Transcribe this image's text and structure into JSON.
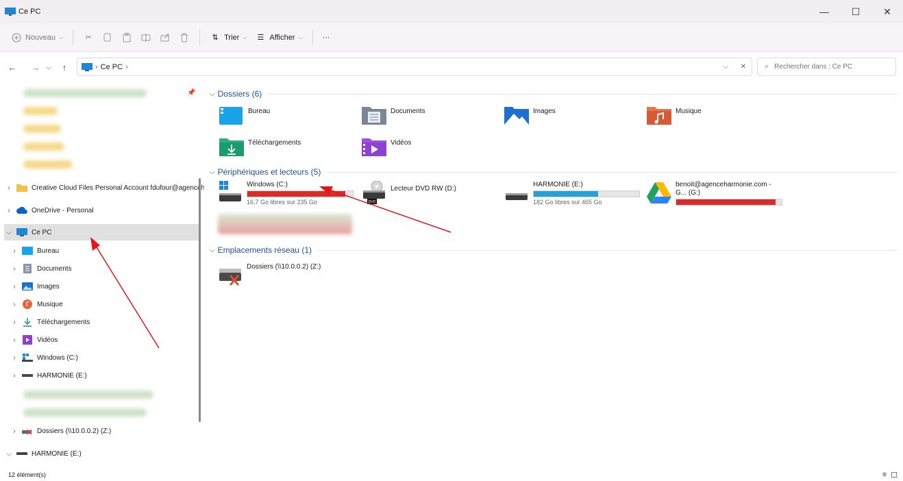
{
  "window": {
    "title": "Ce PC",
    "minimize": "—",
    "maximize": "☐",
    "close": "✕"
  },
  "toolbar": {
    "new_label": "Nouveau",
    "sort_label": "Trier",
    "view_label": "Afficher",
    "more_label": "···"
  },
  "address": {
    "crumb": "Ce PC",
    "search_placeholder": "Rechercher dans : Ce PC"
  },
  "nav": {
    "creative_cloud": "Creative Cloud Files Personal Account fdufour@agenceh",
    "onedrive": "OneDrive - Personal",
    "ce_pc": "Ce PC",
    "children": [
      "Bureau",
      "Documents",
      "Images",
      "Musique",
      "Téléchargements",
      "Vidéos",
      "Windows (C:)",
      "HARMONIE (E:)"
    ],
    "network": "Dossiers (\\\\10.0.0.2) (Z:)",
    "harmonie_root": "HARMONIE (E:)"
  },
  "groups": {
    "folders_header": "Dossiers (6)",
    "devices_header": "Périphériques et lecteurs (5)",
    "network_header": "Emplacements réseau (1)"
  },
  "folders": [
    "Bureau",
    "Documents",
    "Images",
    "Musique",
    "Téléchargements",
    "Vidéos"
  ],
  "drives": {
    "c": {
      "name": "Windows (C:)",
      "free": "16,7 Go libres sur 235 Go",
      "used_fraction": 0.93,
      "color": "#da2a2a"
    },
    "d": {
      "name": "Lecteur DVD RW (D:)"
    },
    "e": {
      "name": "HARMONIE (E:)",
      "free": "182 Go libres sur 465 Go",
      "used_fraction": 0.61,
      "color": "#26a0da"
    },
    "g": {
      "name": "benoit@agenceharmonie.com - G... (G:)",
      "used_fraction": 0.94,
      "color": "#da2a2a"
    }
  },
  "network_location": {
    "name": "Dossiers (\\\\10.0.0.2) (Z:)"
  },
  "status": {
    "count": "12 élément(s)"
  },
  "colors": {
    "accent": "#1f4e9c",
    "annotation_arrow": "#e8141a"
  }
}
